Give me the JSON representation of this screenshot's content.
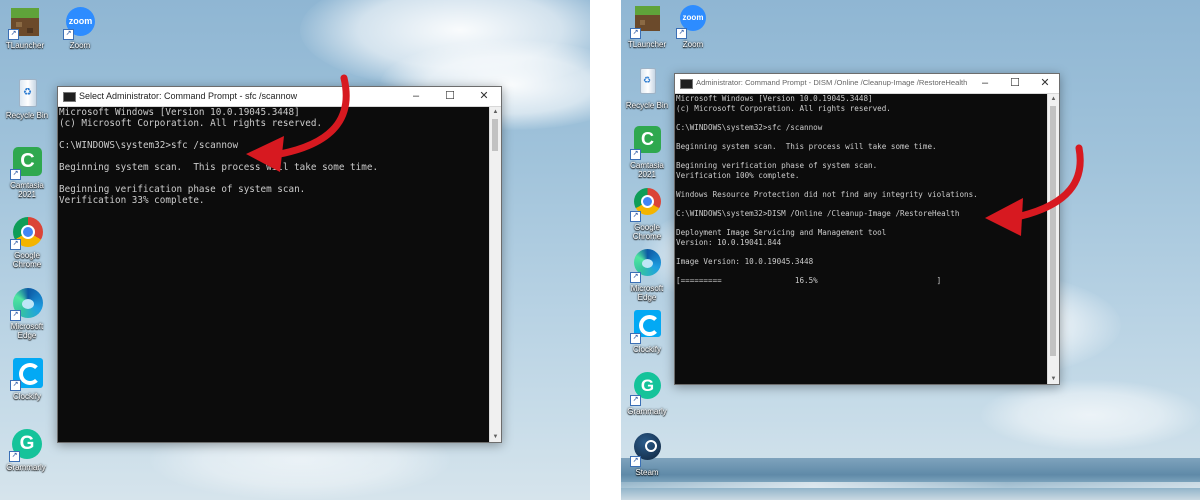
{
  "left": {
    "desktop_icons": [
      {
        "name": "tlauncher",
        "label": "TLauncher"
      },
      {
        "name": "zoom",
        "label": "Zoom",
        "badge": "zoom"
      },
      {
        "name": "recycle-bin",
        "label": "Recycle Bin"
      },
      {
        "name": "camtasia",
        "label": "Camtasia 2021"
      },
      {
        "name": "google-chrome",
        "label": "Google Chrome"
      },
      {
        "name": "microsoft-edge",
        "label": "Microsoft Edge"
      },
      {
        "name": "clockify",
        "label": "Clockify"
      },
      {
        "name": "grammarly",
        "label": "Grammarly"
      }
    ],
    "window": {
      "title": "Select Administrator: Command Prompt - sfc  /scannow",
      "lines": [
        "Microsoft Windows [Version 10.0.19045.3448]",
        "(c) Microsoft Corporation. All rights reserved.",
        "",
        "C:\\WINDOWS\\system32>sfc /scannow",
        "",
        "Beginning system scan.  This process will take some time.",
        "",
        "Beginning verification phase of system scan.",
        "Verification 33% complete."
      ]
    }
  },
  "right": {
    "desktop_icons": [
      {
        "name": "tlauncher",
        "label": "TLauncher"
      },
      {
        "name": "zoom",
        "label": "Zoom",
        "badge": "zoom"
      },
      {
        "name": "recycle-bin",
        "label": "Recycle Bin"
      },
      {
        "name": "camtasia",
        "label": "Camtasia 2021"
      },
      {
        "name": "google-chrome",
        "label": "Google Chrome"
      },
      {
        "name": "microsoft-edge",
        "label": "Microsoft Edge"
      },
      {
        "name": "clockify",
        "label": "Clockify"
      },
      {
        "name": "grammarly",
        "label": "Grammarly"
      },
      {
        "name": "steam",
        "label": "Steam"
      }
    ],
    "window": {
      "title": "Administrator: Command Prompt - DISM  /Online /Cleanup-Image /RestoreHealth",
      "lines": [
        "Microsoft Windows [Version 10.0.19045.3448]",
        "(c) Microsoft Corporation. All rights reserved.",
        "",
        "C:\\WINDOWS\\system32>sfc /scannow",
        "",
        "Beginning system scan.  This process will take some time.",
        "",
        "Beginning verification phase of system scan.",
        "Verification 100% complete.",
        "",
        "Windows Resource Protection did not find any integrity violations.",
        "",
        "C:\\WINDOWS\\system32>DISM /Online /Cleanup-Image /RestoreHealth",
        "",
        "Deployment Image Servicing and Management tool",
        "Version: 10.0.19041.844",
        "",
        "Image Version: 10.0.19045.3448",
        "",
        "[=========                16.5%                          ]"
      ]
    }
  },
  "annotation_color": "#d71920"
}
